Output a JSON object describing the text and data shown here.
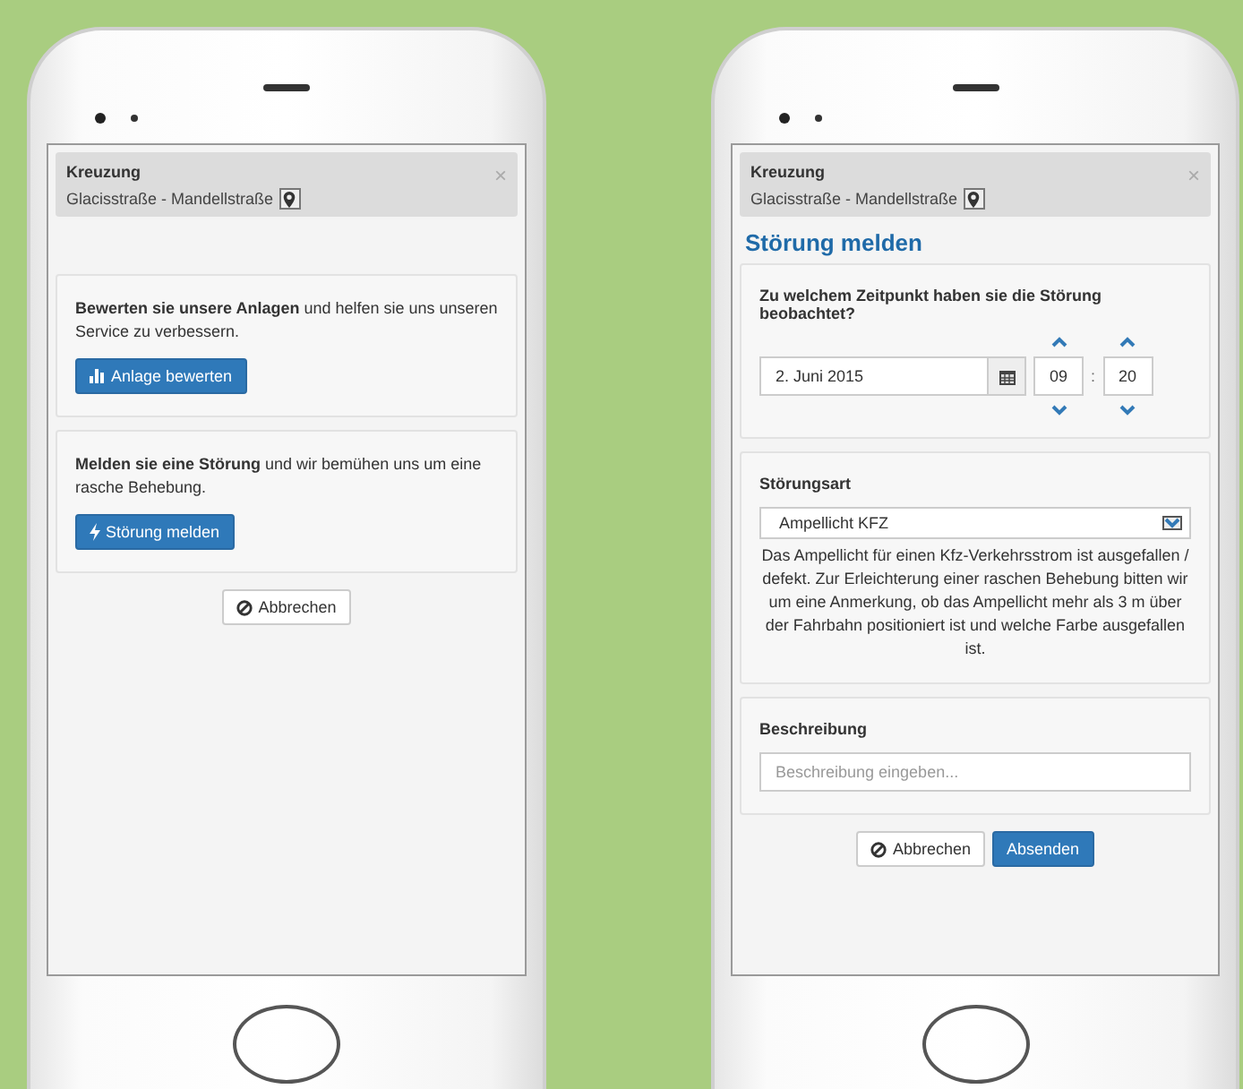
{
  "phones": [
    {
      "header": {
        "title": "Kreuzung",
        "subtitle": "Glacisstraße - Mandellstraße",
        "close": "×"
      },
      "panels": [
        {
          "kind": "action",
          "text": "**Bewerten sie unsere Anlagen** und helfen sie uns unseren Service zu verbessern.",
          "button": "Anlage bewerten"
        },
        {
          "kind": "action",
          "text": "**Melden sie eine Störung** und wir bemühen uns um eine rasche Behebung.",
          "button": "Störung melden"
        }
      ],
      "buttons": [
        {
          "label": "Abbrechen",
          "kind": "cancel"
        }
      ]
    },
    {
      "header": {
        "title": "Kreuzung",
        "subtitle": "Glacisstraße - Mandellstraße",
        "close": "×"
      },
      "heading": "Störung melden",
      "panels": [
        {
          "kind": "datetime",
          "label": "Zu welchem Zeitpunkt haben sie die Störung beobachtet?",
          "date": "2. Juni 2015",
          "hour": "09",
          "separator": ":",
          "minute": "20"
        },
        {
          "kind": "select",
          "label": "Störungsart",
          "value": "Ampellicht KFZ",
          "description": "Das Ampellicht für einen Kfz-Verkehrsstrom ist ausgefallen / defekt. Zur Erleichterung einer raschen Behebung bitten wir um eine Anmerkung, ob das Ampellicht mehr als 3 m über der Fahrbahn positioniert ist und welche Farbe ausgefallen ist."
        },
        {
          "kind": "text",
          "label": "Beschreibung",
          "placeholder": "Beschreibung eingeben..."
        }
      ],
      "buttons": [
        {
          "label": "Abbrechen",
          "kind": "cancel"
        },
        {
          "label": "Absenden",
          "kind": "submit"
        }
      ]
    }
  ]
}
